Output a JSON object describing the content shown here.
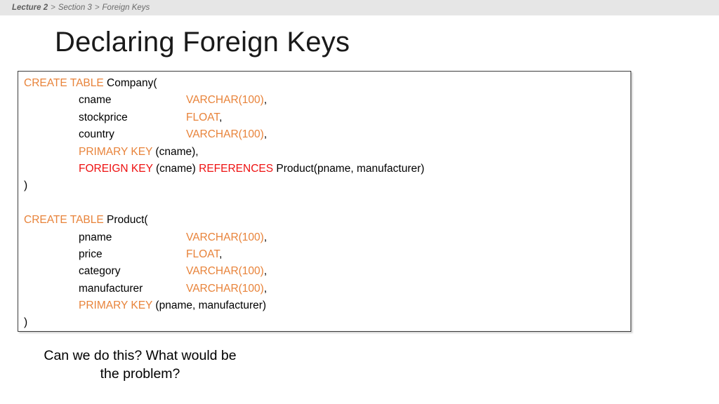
{
  "breadcrumb": {
    "items": [
      "Lecture 2",
      "Section 3",
      "Foreign Keys"
    ],
    "separator": ">"
  },
  "title": "Declaring Foreign Keys",
  "colors": {
    "keyword_orange": "#e8833a",
    "keyword_red": "#ee1111",
    "text_black": "#000000",
    "bar_gray": "#e6e6e6",
    "box_border": "#3b3b3b"
  },
  "code_block": {
    "lines": [
      {
        "type": "stmt",
        "kw": "CREATE TABLE",
        "kw_color": "orange",
        "rest": " Company("
      },
      {
        "type": "col",
        "name": "cname",
        "datatype": "VARCHAR(100)",
        "comma": ","
      },
      {
        "type": "col",
        "name": "stockprice",
        "datatype": "FLOAT",
        "comma": ","
      },
      {
        "type": "col",
        "name": "country",
        "datatype": "VARCHAR(100)",
        "comma": ","
      },
      {
        "type": "constraint",
        "kw": "PRIMARY KEY",
        "kw_color": "orange",
        "rest": " (cname),",
        "kw2": "",
        "rest2": ""
      },
      {
        "type": "constraint",
        "kw": "FOREIGN KEY",
        "kw_color": "red",
        "rest": " (cname) ",
        "kw2": "REFERENCES",
        "rest2": " Product(pname, manufacturer)"
      },
      {
        "type": "stmt",
        "kw": "",
        "kw_color": "none",
        "rest": ")"
      },
      {
        "type": "blank"
      },
      {
        "type": "stmt",
        "kw": "CREATE TABLE",
        "kw_color": "orange",
        "rest": " Product("
      },
      {
        "type": "col",
        "name": "pname",
        "datatype": "VARCHAR(100)",
        "comma": ","
      },
      {
        "type": "col",
        "name": "price",
        "datatype": "FLOAT",
        "comma": ","
      },
      {
        "type": "col",
        "name": "category",
        "datatype": "VARCHAR(100)",
        "comma": ","
      },
      {
        "type": "col",
        "name": "manufacturer",
        "datatype": "VARCHAR(100)",
        "comma": ","
      },
      {
        "type": "constraint",
        "kw": "PRIMARY KEY",
        "kw_color": "orange",
        "rest": " (pname, manufacturer)",
        "kw2": "",
        "rest2": ""
      },
      {
        "type": "stmt",
        "kw": "",
        "kw_color": "none",
        "rest": ")"
      }
    ]
  },
  "caption": {
    "line1": "Can we do this? What would be",
    "line2": "the problem?"
  }
}
